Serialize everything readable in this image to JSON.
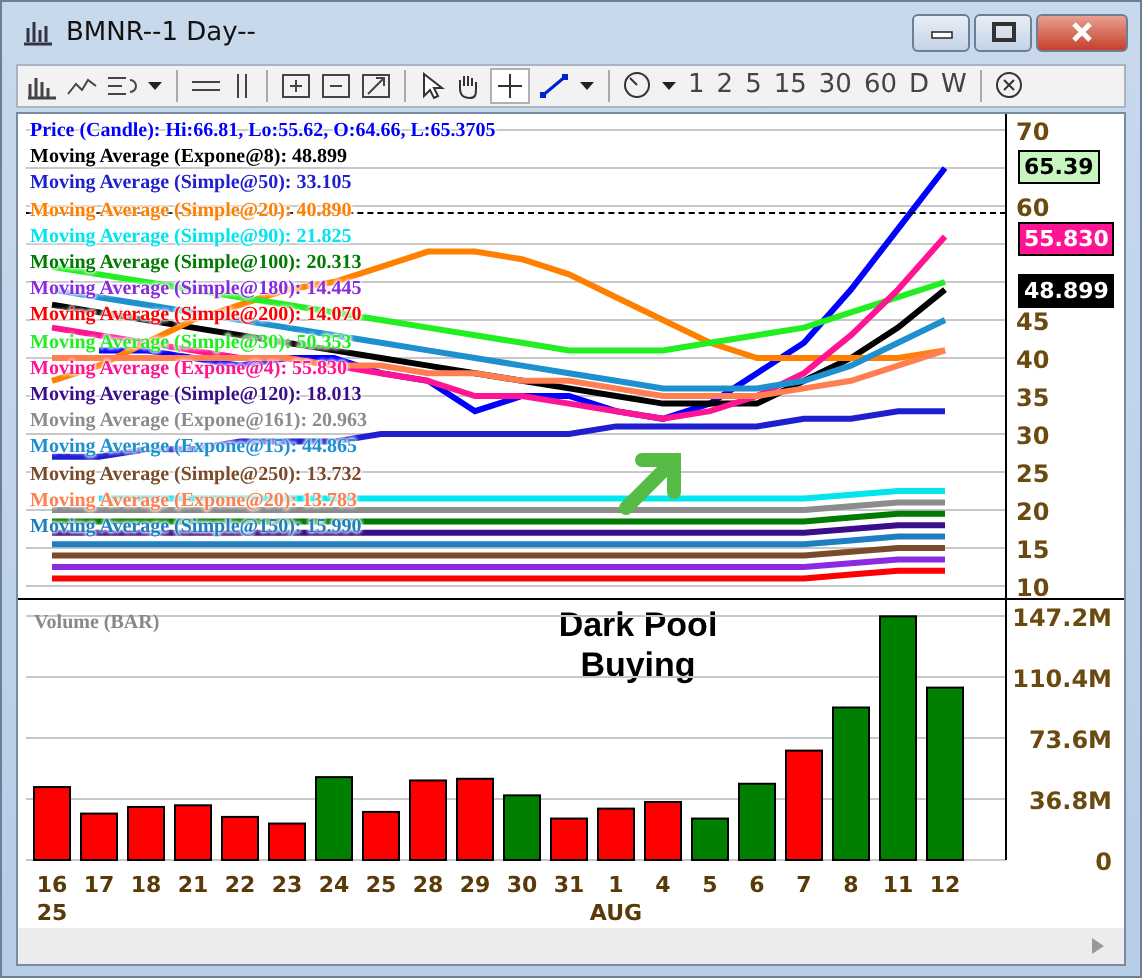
{
  "window": {
    "title": "BMNR--1 Day--"
  },
  "toolbar": {
    "crosshair_active": true,
    "timeframes": [
      "1",
      "2",
      "5",
      "15",
      "30",
      "60",
      "D",
      "W"
    ]
  },
  "price_panel": {
    "price_tags": [
      {
        "label": "65.39",
        "color": "#c8f5c0"
      },
      {
        "label": "55.830",
        "color": "#ff1493"
      },
      {
        "label": "48.899",
        "color": "#000000"
      }
    ],
    "note": "Dark Pool Buying",
    "chart_data": {
      "type": "line",
      "grid": true,
      "series": [
        {
          "name": "Price (Candle): Hi:66.81, Lo:55.62, O:64.66, L:65.3705",
          "color": "#0000ff",
          "values": [
            null,
            41,
            41,
            40,
            39,
            40,
            40,
            38,
            37,
            33,
            35,
            35,
            33,
            32,
            34,
            38,
            42,
            49,
            57,
            65
          ]
        },
        {
          "name": "Moving Average (Expone@8): 48.899",
          "color": "#000000",
          "values": [
            47,
            46,
            45,
            44,
            43,
            42,
            41,
            40,
            39,
            38,
            37,
            36,
            35,
            34,
            34,
            34,
            37,
            40,
            44,
            49
          ]
        },
        {
          "name": "Moving Average (Simple@50): 33.105",
          "color": "#1f1fd0",
          "values": [
            27,
            27,
            28,
            28,
            29,
            29,
            29,
            30,
            30,
            30,
            30,
            30,
            31,
            31,
            31,
            31,
            32,
            32,
            33,
            33
          ]
        },
        {
          "name": "Moving Average (Simple@20): 40.890",
          "color": "#ff8000",
          "values": [
            37,
            39,
            42,
            45,
            47,
            49,
            50,
            52,
            54,
            54,
            53,
            51,
            48,
            45,
            42,
            40,
            40,
            40,
            40,
            41
          ]
        },
        {
          "name": "Moving Average (Simple@90): 21.825",
          "color": "#00e5ee",
          "values": [
            null,
            21.5,
            21.5,
            21.5,
            21.5,
            21.5,
            21.5,
            21.5,
            21.5,
            21.5,
            21.5,
            21.5,
            21.5,
            21.5,
            21.5,
            21.5,
            21.5,
            22,
            22.5,
            22.5
          ]
        },
        {
          "name": "Moving Average (Simple@100): 20.313",
          "color": "#007a00",
          "values": [
            18.5,
            18.5,
            18.5,
            18.5,
            18.5,
            18.5,
            18.5,
            18.5,
            18.5,
            18.5,
            18.5,
            18.5,
            18.5,
            18.5,
            18.5,
            18.5,
            18.5,
            19,
            19.5,
            19.5
          ]
        },
        {
          "name": "Moving Average (Simple@180): 14.445",
          "color": "#8a2be2",
          "values": [
            12.5,
            12.5,
            12.5,
            12.5,
            12.5,
            12.5,
            12.5,
            12.5,
            12.5,
            12.5,
            12.5,
            12.5,
            12.5,
            12.5,
            12.5,
            12.5,
            12.5,
            13,
            13.5,
            13.5
          ]
        },
        {
          "name": "Moving Average (Simple@200): 14.070",
          "color": "#ff0000",
          "values": [
            11,
            11,
            11,
            11,
            11,
            11,
            11,
            11,
            11,
            11,
            11,
            11,
            11,
            11,
            11,
            11,
            11,
            11.5,
            12,
            12
          ]
        },
        {
          "name": "Moving Average (Simple@30): 50.353",
          "color": "#22ee22",
          "values": [
            52,
            51,
            50,
            null,
            48,
            47,
            46,
            45,
            44,
            43,
            42,
            41,
            41,
            41,
            42,
            43,
            44,
            46,
            48,
            50
          ]
        },
        {
          "name": "Moving Average (Expone@4): 55.830",
          "color": "#ff1493",
          "values": [
            44,
            43,
            42,
            41,
            40,
            40,
            39,
            38,
            37,
            35,
            35,
            34,
            33,
            32,
            33,
            35,
            38,
            43,
            49,
            56
          ]
        },
        {
          "name": "Moving Average (Simple@120): 18.013",
          "color": "#3a0e8a",
          "values": [
            17,
            17,
            17,
            17,
            17,
            17,
            17,
            17,
            17,
            17,
            17,
            17,
            17,
            17,
            17,
            17,
            17,
            17.5,
            18,
            18
          ]
        },
        {
          "name": "Moving Average (Expone@161): 20.963",
          "color": "#8c8c8c",
          "values": [
            20,
            20,
            20,
            20,
            20,
            20,
            20,
            20,
            20,
            20,
            20,
            20,
            20,
            20,
            20,
            20,
            20,
            20.5,
            21,
            21
          ]
        },
        {
          "name": "Moving Average (Expone@15): 44.865",
          "color": "#1e90d0",
          "values": [
            49,
            48,
            47,
            null,
            45,
            44,
            43,
            42,
            41,
            40,
            39,
            38,
            37,
            36,
            36,
            36,
            37,
            39,
            42,
            45
          ]
        },
        {
          "name": "Moving Average (Simple@250): 13.732",
          "color": "#7a4a2a",
          "values": [
            14,
            14,
            14,
            14,
            14,
            14,
            14,
            14,
            14,
            14,
            14,
            14,
            14,
            14,
            14,
            14,
            14,
            14.5,
            15,
            15
          ]
        },
        {
          "name": "Moving Average (Expone@20): 13.783",
          "color": "#ff7f50",
          "values": [
            40,
            40,
            40,
            40,
            40,
            40,
            39,
            39,
            38,
            38,
            37,
            37,
            36,
            35,
            35,
            35,
            36,
            37,
            39,
            41
          ]
        },
        {
          "name": "Moving Average (Simple@150): 15.990",
          "color": "#1e7fc0",
          "values": [
            15.5,
            15.5,
            15.5,
            15.5,
            15.5,
            15.5,
            15.5,
            15.5,
            15.5,
            15.5,
            15.5,
            15.5,
            15.5,
            15.5,
            15.5,
            15.5,
            15.5,
            16,
            16.5,
            16.5
          ]
        }
      ],
      "ylim": [
        10,
        70
      ],
      "yticks": [
        10,
        15,
        20,
        25,
        30,
        35,
        40,
        45,
        60,
        70
      ]
    }
  },
  "volume_panel": {
    "bars": [
      {
        "color": "#ff0000"
      },
      {
        "color": "#ff0000"
      },
      {
        "color": "#ff0000"
      },
      {
        "color": "#ff0000"
      },
      {
        "color": "#ff0000"
      },
      {
        "color": "#ff0000"
      },
      {
        "color": "#008000"
      },
      {
        "color": "#ff0000"
      },
      {
        "color": "#ff0000"
      },
      {
        "color": "#ff0000"
      },
      {
        "color": "#008000"
      },
      {
        "color": "#ff0000"
      },
      {
        "color": "#ff0000"
      },
      {
        "color": "#ff0000"
      },
      {
        "color": "#008000"
      },
      {
        "color": "#008000"
      },
      {
        "color": "#ff0000"
      },
      {
        "color": "#008000"
      },
      {
        "color": "#008000"
      },
      {
        "color": "#008000"
      }
    ],
    "chart_data": {
      "type": "bar",
      "grid": true,
      "categories": [
        "16",
        "17",
        "18",
        "21",
        "22",
        "23",
        "24",
        "25",
        "28",
        "29",
        "30",
        "31",
        "1",
        "4",
        "5",
        "6",
        "7",
        "8",
        "11",
        "12"
      ],
      "series": [
        {
          "name": "Volume (BAR)",
          "values": [
            44,
            28,
            32,
            33,
            26,
            22,
            50,
            29,
            48,
            49,
            39,
            25,
            31,
            35,
            25,
            46,
            66,
            92,
            147,
            104
          ]
        }
      ],
      "ylim": [
        0,
        147.2
      ],
      "yticks": [
        {
          "value": 0,
          "label": "0"
        },
        {
          "value": 36.8,
          "label": "36.8M"
        },
        {
          "value": 73.6,
          "label": "73.6M"
        },
        {
          "value": 110.4,
          "label": "110.4M"
        },
        {
          "value": 147.2,
          "label": "147.2M"
        }
      ]
    }
  },
  "date_marks": [
    {
      "kind": "year",
      "label": "25"
    },
    {
      "kind": "month",
      "label": "AUG"
    }
  ]
}
